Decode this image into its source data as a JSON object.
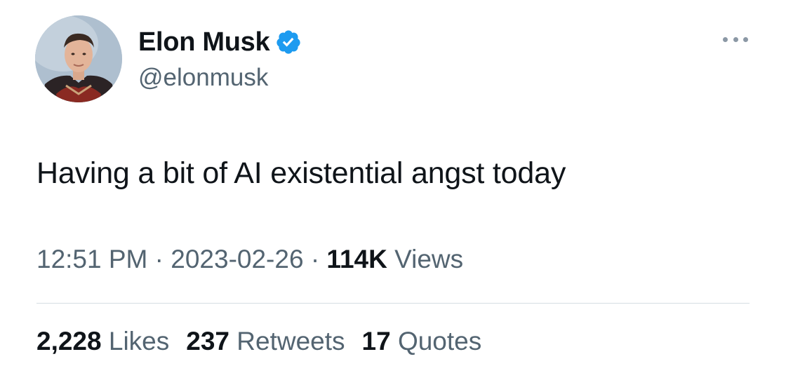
{
  "author": {
    "display_name": "Elon Musk",
    "handle": "@elonmusk",
    "verified": true,
    "verified_color": "#1d9bf0"
  },
  "tweet": {
    "text": "Having a bit of AI existential angst today",
    "time": "12:51 PM",
    "date": "2023-02-26",
    "separator": "·",
    "views_count": "114K",
    "views_label": "Views"
  },
  "stats": {
    "likes_count": "2,228",
    "likes_label": "Likes",
    "retweets_count": "237",
    "retweets_label": "Retweets",
    "quotes_count": "17",
    "quotes_label": "Quotes"
  },
  "icons": {
    "avatar": "profile-photo",
    "verified": "verified-badge-icon",
    "more": "more-options-icon"
  },
  "colors": {
    "primary_text": "#0f1419",
    "secondary_text": "#536471",
    "divider": "#d6dde2"
  }
}
